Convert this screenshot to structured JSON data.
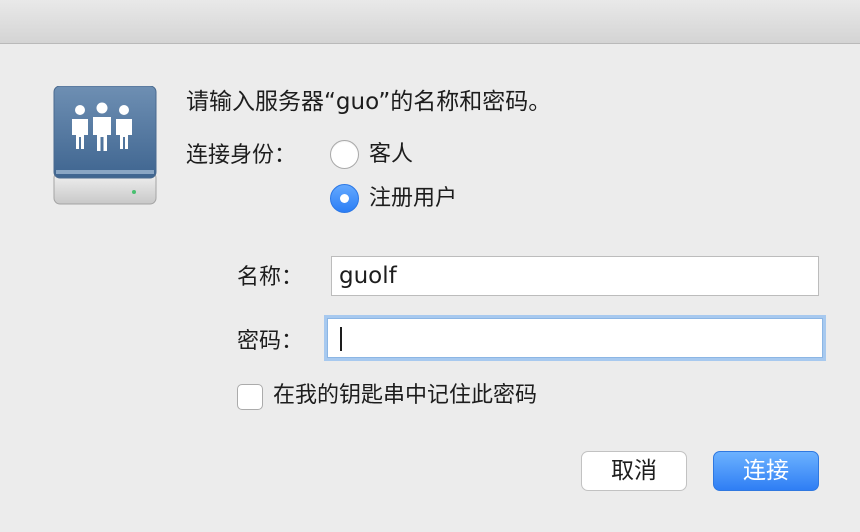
{
  "dialog": {
    "prompt": "请输入服务器“guo”的名称和密码。",
    "connect_as_label": "连接身份：",
    "options": [
      {
        "label": "客人",
        "selected": false
      },
      {
        "label": "注册用户",
        "selected": true
      }
    ],
    "name_label": "名称：",
    "name_value": "guolf",
    "password_label": "密码：",
    "password_value": "",
    "remember_label": "在我的钥匙串中记住此密码",
    "remember_checked": false,
    "cancel_label": "取消",
    "connect_label": "连接"
  },
  "icons": {
    "server": "network-server-icon"
  },
  "colors": {
    "accent": "#2f7ef4",
    "background": "#ececec"
  }
}
